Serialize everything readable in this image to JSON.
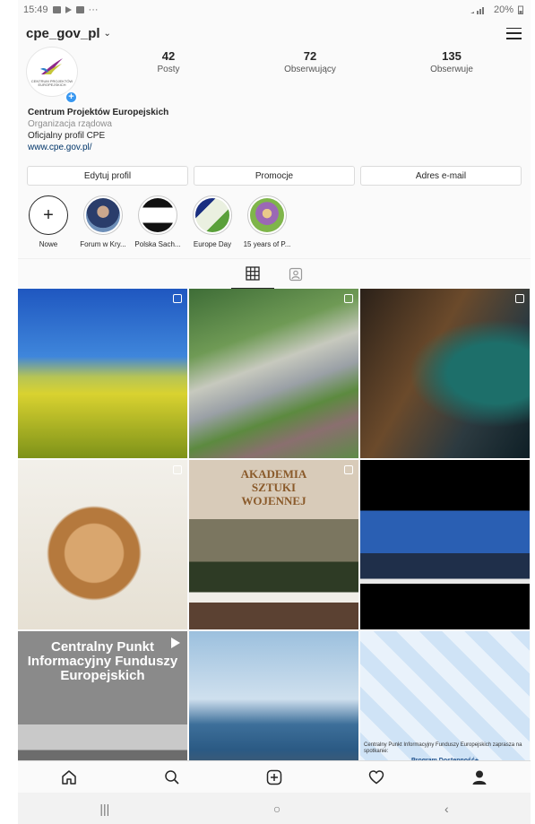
{
  "status_bar": {
    "time": "15:49",
    "more": "···",
    "battery": "20%"
  },
  "header": {
    "username": "cpe_gov_pl",
    "chevron": "⌄"
  },
  "profile": {
    "avatar_logo_text": "CENTRUM PROJEKTÓW EUROPEJSKICH",
    "stats": [
      {
        "value": "42",
        "label": "Posty"
      },
      {
        "value": "72",
        "label": "Obserwujący"
      },
      {
        "value": "135",
        "label": "Obserwuje"
      }
    ],
    "bio": {
      "name": "Centrum Projektów Europejskich",
      "category": "Organizacja rządowa",
      "description": "Oficjalny profil CPE",
      "link": "www.cpe.gov.pl/"
    }
  },
  "actions": {
    "edit": "Edytuj profil",
    "promo": "Promocje",
    "email": "Adres e-mail"
  },
  "highlights": [
    {
      "label": "Nowe",
      "icon": "plus-icon"
    },
    {
      "label": "Forum w Kry..."
    },
    {
      "label": "Polska Sach..."
    },
    {
      "label": "Europe Day"
    },
    {
      "label": "15 years of P..."
    }
  ],
  "tabs": [
    "grid-icon",
    "tagged-icon"
  ],
  "posts": [
    {
      "name": "rapeseed-field",
      "overlay": "multi"
    },
    {
      "name": "ski-jump-stadium",
      "overlay": "multi"
    },
    {
      "name": "museum-exhibit",
      "overlay": "multi"
    },
    {
      "name": "puppy",
      "overlay": "multi"
    },
    {
      "name": "military-signing",
      "overlay": "multi",
      "caption_line1": "AKADEMIA",
      "caption_line2": "SZTUKI",
      "caption_line3": "WOJENNEJ"
    },
    {
      "name": "conference-panel",
      "overlay": "none"
    },
    {
      "name": "fund-info-video",
      "overlay": "video",
      "text": "Centralny Punkt Informacyjny Funduszy Europejskich"
    },
    {
      "name": "pier-sea",
      "overlay": "none"
    },
    {
      "name": "accessibility-program",
      "overlay": "none",
      "caption": "Centralny Punkt Informacyjny Funduszy Europejskich zaprasza na spotkanie:",
      "caption2": "Program Dostępność+"
    }
  ],
  "bottom_nav": [
    "home-icon",
    "search-icon",
    "add-post-icon",
    "heart-icon",
    "profile-icon"
  ],
  "system_nav": {
    "recents": "|||",
    "home": "○",
    "back": "‹"
  }
}
